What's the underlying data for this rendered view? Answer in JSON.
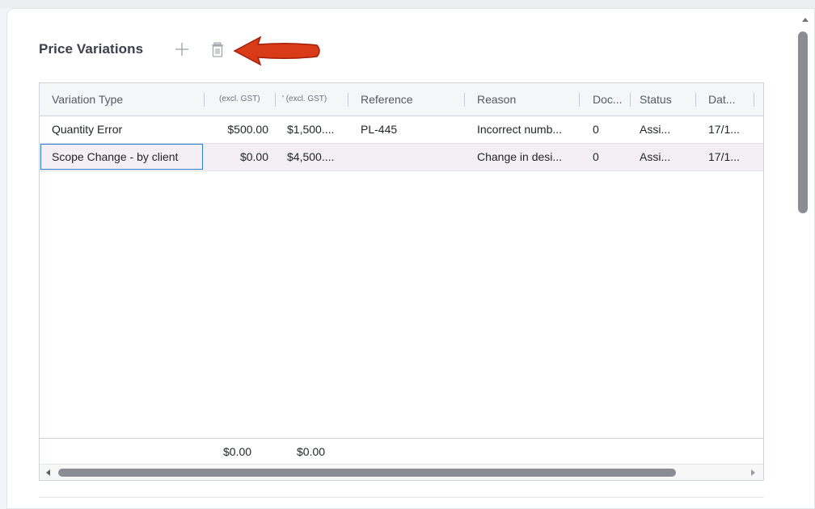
{
  "section": {
    "title": "Price Variations",
    "add_icon": "plus-icon",
    "delete_icon": "trash-icon",
    "annotation": "red-arrow-pointing-left"
  },
  "grid": {
    "columns": [
      {
        "label": "Variation Type"
      },
      {
        "label": "(excl. GST)"
      },
      {
        "label": "' (excl. GST)"
      },
      {
        "label": "Reference"
      },
      {
        "label": "Reason"
      },
      {
        "label": "Doc..."
      },
      {
        "label": "Status"
      },
      {
        "label": "Dat..."
      }
    ],
    "rows": [
      {
        "variation_type": "Quantity Error",
        "amount_excl_gst": "$500.00",
        "total_excl_gst": "$1,500....",
        "reference": "PL-445",
        "reason": "Incorrect numb...",
        "docs": "0",
        "status": "Assi...",
        "date": "17/1..."
      },
      {
        "variation_type": "Scope Change - by client",
        "amount_excl_gst": "$0.00",
        "total_excl_gst": "$4,500....",
        "reference": "",
        "reason": "Change in desi...",
        "docs": "0",
        "status": "Assi...",
        "date": "17/1..."
      }
    ],
    "selected_row_index": 1,
    "footer": {
      "amount_total": "$0.00",
      "total_total": "$0.00"
    }
  },
  "colors": {
    "accent": "#2f7fd1",
    "selected_row": "#f3eff5",
    "arrow": "#d93a18"
  }
}
